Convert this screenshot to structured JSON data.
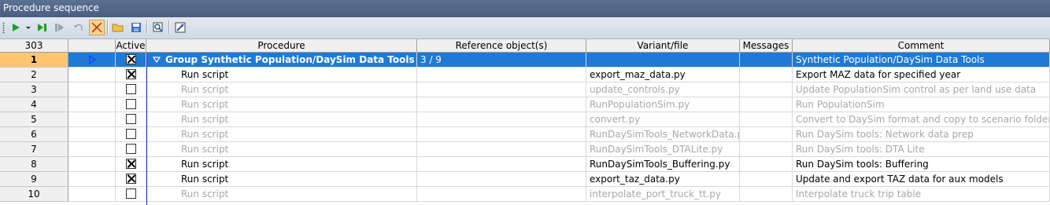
{
  "window": {
    "title": "Procedure sequence"
  },
  "toolbar": {
    "icons": [
      "run-icon",
      "run-dropdown-icon",
      "run-to-icon",
      "step-icon",
      "undo-icon",
      "deactivate-icon",
      "open-folder-icon",
      "save-icon",
      "find-icon",
      "settings-icon"
    ]
  },
  "table": {
    "columns": {
      "rownum": "303",
      "extra": "",
      "active": "Active",
      "procedure": "Procedure",
      "reference": "Reference object(s)",
      "variant": "Variant/file",
      "messages": "Messages",
      "comment": "Comment"
    },
    "rows": [
      {
        "num": "1",
        "active": true,
        "procedure": "Group Synthetic Population/DaySim Data Tools",
        "reference": "3 / 9",
        "variant": "",
        "messages": "",
        "comment": "Synthetic Population/DaySim Data Tools"
      },
      {
        "num": "2",
        "active": true,
        "procedure": "Run script",
        "reference": "",
        "variant": "export_maz_data.py",
        "messages": "",
        "comment": "Export MAZ data for specified year"
      },
      {
        "num": "3",
        "active": false,
        "procedure": "Run script",
        "reference": "",
        "variant": "update_controls.py",
        "messages": "",
        "comment": "Update PopulationSim control as per land use data"
      },
      {
        "num": "4",
        "active": false,
        "procedure": "Run script",
        "reference": "",
        "variant": "RunPopulationSim.py",
        "messages": "",
        "comment": "Run PopulationSim"
      },
      {
        "num": "5",
        "active": false,
        "procedure": "Run script",
        "reference": "",
        "variant": "convert.py",
        "messages": "",
        "comment": "Convert to DaySim format and copy to scenario folder"
      },
      {
        "num": "6",
        "active": false,
        "procedure": "Run script",
        "reference": "",
        "variant": "RunDaySimTools_NetworkData.py",
        "messages": "",
        "comment": "Run DaySim tools: Network data prep"
      },
      {
        "num": "7",
        "active": false,
        "procedure": "Run script",
        "reference": "",
        "variant": "RunDaySimTools_DTALite.py",
        "messages": "",
        "comment": "Run DaySim tools: DTA Lite"
      },
      {
        "num": "8",
        "active": true,
        "procedure": "Run script",
        "reference": "",
        "variant": "RunDaySimTools_Buffering.py",
        "messages": "",
        "comment": "Run DaySim tools: Buffering"
      },
      {
        "num": "9",
        "active": true,
        "procedure": "Run script",
        "reference": "",
        "variant": "export_taz_data.py",
        "messages": "",
        "comment": "Update and export TAZ data for aux models"
      },
      {
        "num": "10",
        "active": false,
        "procedure": "Run script",
        "reference": "",
        "variant": "interpolate_port_truck_tt.py",
        "messages": "",
        "comment": "Interpolate truck trip table"
      }
    ]
  },
  "colors": {
    "selection": "#1e7ad6",
    "row_selected_num": "#ffc672",
    "inactive_text": "#a8a8a8",
    "title_bar": "#4f6486"
  }
}
